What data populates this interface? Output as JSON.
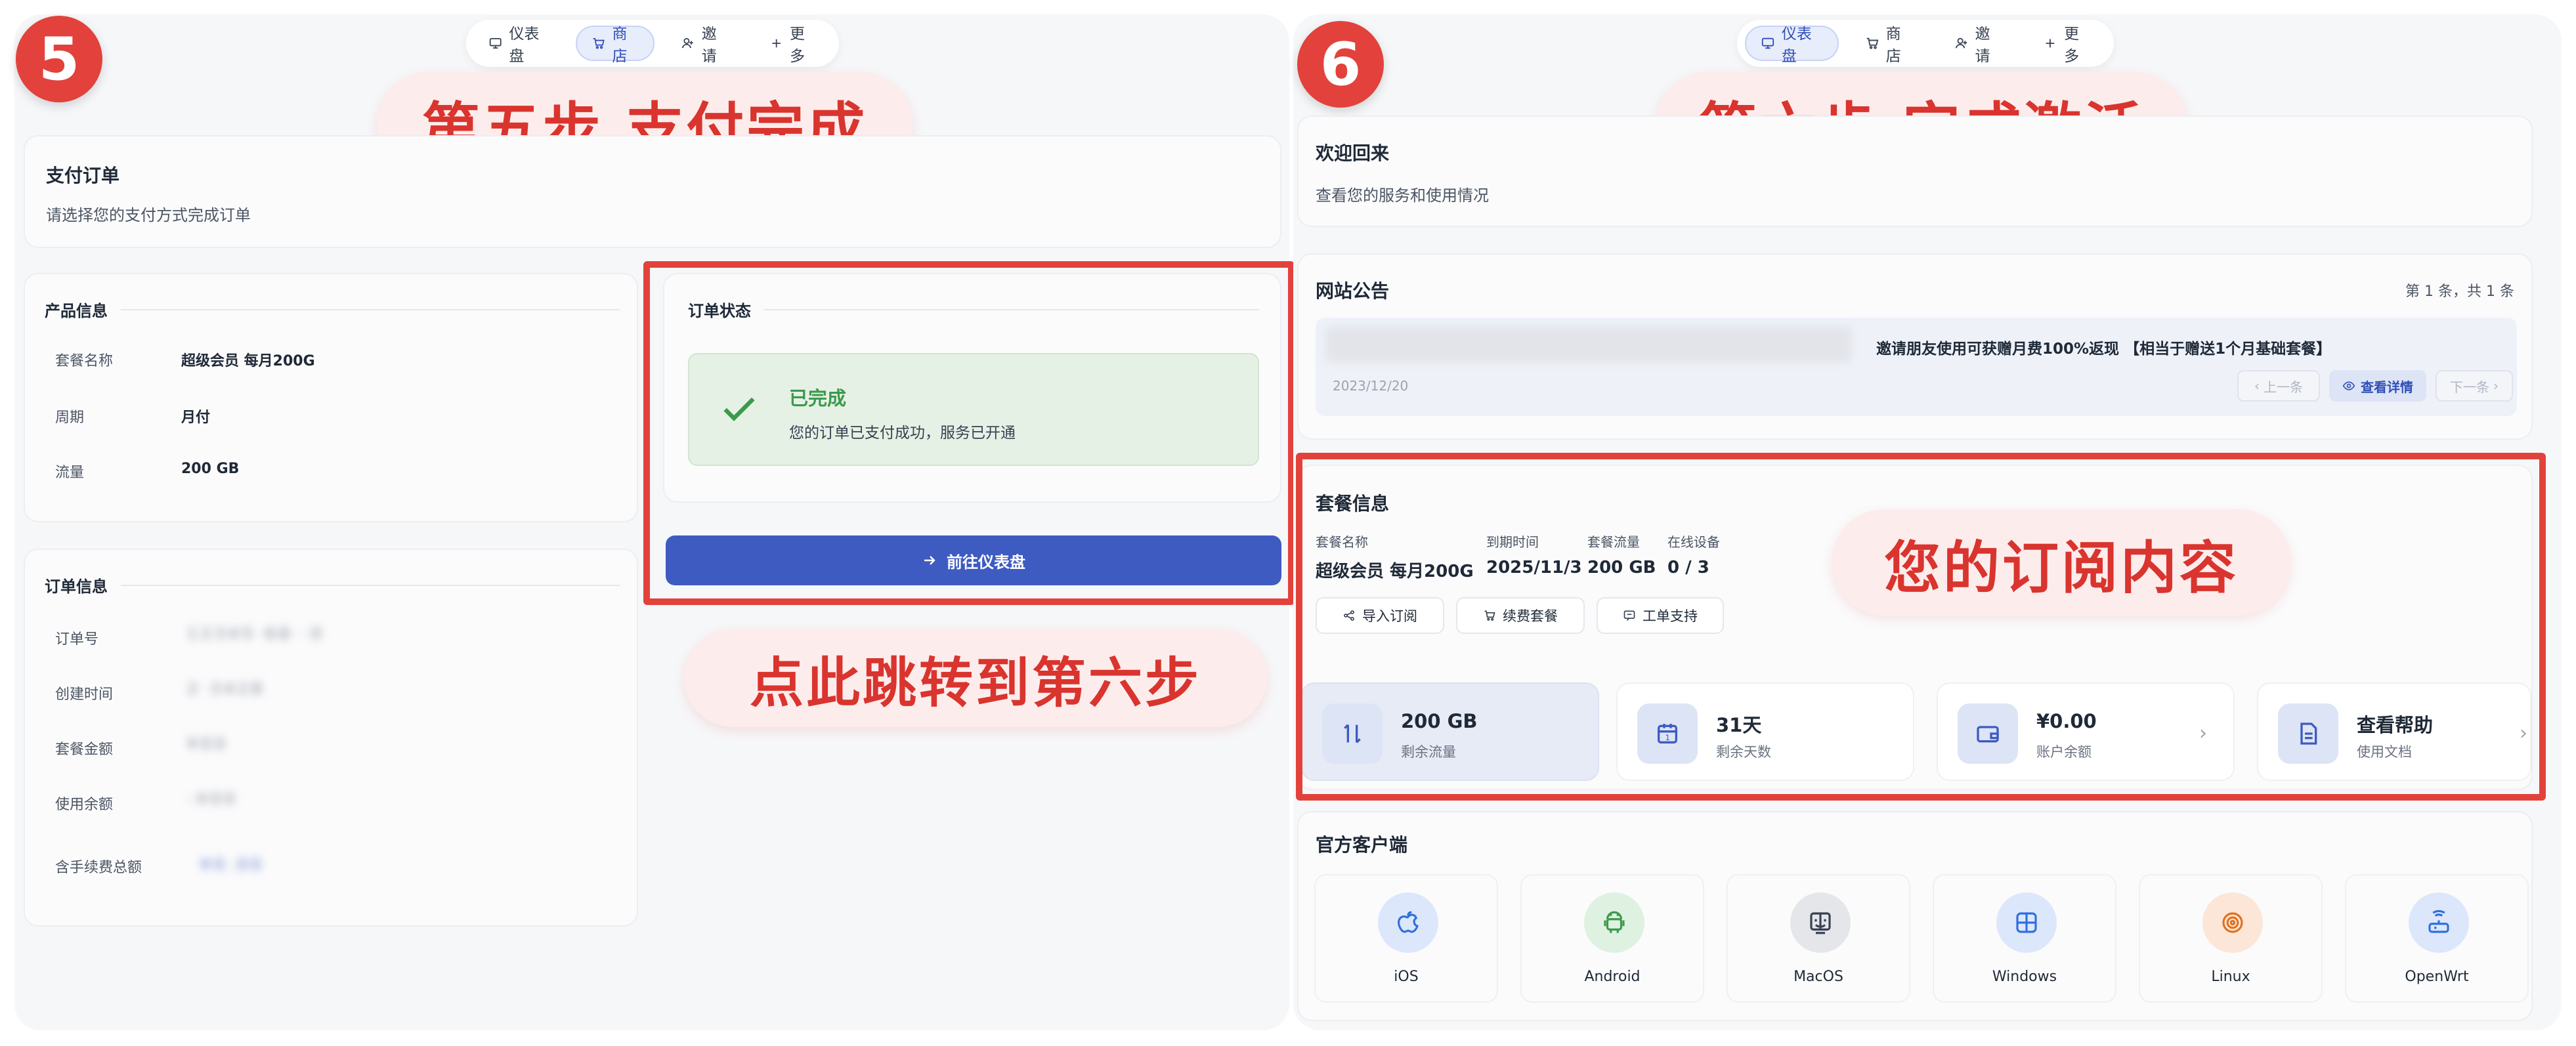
{
  "left": {
    "step_number": "5",
    "nav": {
      "items": [
        {
          "label": "仪表盘",
          "icon": "monitor-icon"
        },
        {
          "label": "商店",
          "icon": "cart-icon"
        },
        {
          "label": "邀请",
          "icon": "user-plus-icon"
        },
        {
          "label": "更多",
          "icon": "plus-icon"
        }
      ],
      "active_index": 1
    },
    "callout_title": "第五步 支付完成",
    "payment": {
      "title": "支付订单",
      "subtitle": "请选择您的支付方式完成订单"
    },
    "product_info": {
      "section_title": "产品信息",
      "rows": [
        {
          "label": "套餐名称",
          "value": "超级会员 每月200G"
        },
        {
          "label": "周期",
          "value": "月付"
        },
        {
          "label": "流量",
          "value": "200 GB"
        }
      ]
    },
    "order_info": {
      "section_title": "订单信息",
      "rows": [
        {
          "label": "订单号",
          "value": "1 2 3 4 5 · 6 8 · · 0"
        },
        {
          "label": "创建时间",
          "value": "2 · 3 4 2 8"
        },
        {
          "label": "套餐金额",
          "value": "¥ 0 0"
        },
        {
          "label": "使用余额",
          "value": "- ¥ 0 0"
        },
        {
          "label": "含手续费总额",
          "value": "¥ 0 . 0 0"
        }
      ]
    },
    "order_status": {
      "section_title": "订单状态",
      "status": "已完成",
      "message": "您的订单已支付成功，服务已开通"
    },
    "dashboard_button": "前往仪表盘",
    "callout_jump": "点此跳转到第六步"
  },
  "right": {
    "step_number": "6",
    "nav": {
      "items": [
        {
          "label": "仪表盘",
          "icon": "monitor-icon"
        },
        {
          "label": "商店",
          "icon": "cart-icon"
        },
        {
          "label": "邀请",
          "icon": "user-plus-icon"
        },
        {
          "label": "更多",
          "icon": "plus-icon"
        }
      ],
      "active_index": 0
    },
    "callout_title": "第六步 完成激活",
    "welcome": {
      "title": "欢迎回来",
      "subtitle": "查看您的服务和使用情况"
    },
    "announcement": {
      "title": "网站公告",
      "counter": "第 1 条，共 1 条",
      "text": "邀请朋友使用可获赠月费100%返现 【相当于赠送1个月基础套餐】",
      "date": "2023/12/20",
      "prev": "上一条",
      "details": "查看详情",
      "next": "下一条"
    },
    "plan": {
      "title": "套餐信息",
      "columns": [
        {
          "label": "套餐名称",
          "value": "超级会员 每月200G"
        },
        {
          "label": "到期时间",
          "value": "2025/11/3"
        },
        {
          "label": "套餐流量",
          "value": "200 GB"
        },
        {
          "label": "在线设备",
          "value": "0 / 3"
        }
      ],
      "buttons": [
        "导入订阅",
        "续费套餐",
        "工单支持"
      ]
    },
    "callout_subscription": "您的订阅内容",
    "stats": [
      {
        "value": "200 GB",
        "sub": "剩余流量",
        "icon": "traffic-icon"
      },
      {
        "value": "31天",
        "sub": "剩余天数",
        "icon": "calendar-icon"
      },
      {
        "value": "¥0.00",
        "sub": "账户余额",
        "icon": "wallet-icon"
      },
      {
        "value": "查看帮助",
        "sub": "使用文档",
        "icon": "document-icon"
      }
    ],
    "clients": {
      "title": "官方客户端",
      "items": [
        {
          "label": "iOS",
          "icon": "apple-icon"
        },
        {
          "label": "Android",
          "icon": "android-icon"
        },
        {
          "label": "MacOS",
          "icon": "finder-icon"
        },
        {
          "label": "Windows",
          "icon": "windows-icon"
        },
        {
          "label": "Linux",
          "icon": "linux-icon"
        },
        {
          "label": "OpenWrt",
          "icon": "router-icon"
        }
      ]
    }
  },
  "colors": {
    "accent_red": "#e2423b",
    "primary_blue": "#3e5bc1",
    "success_green": "#3b9a4c"
  }
}
